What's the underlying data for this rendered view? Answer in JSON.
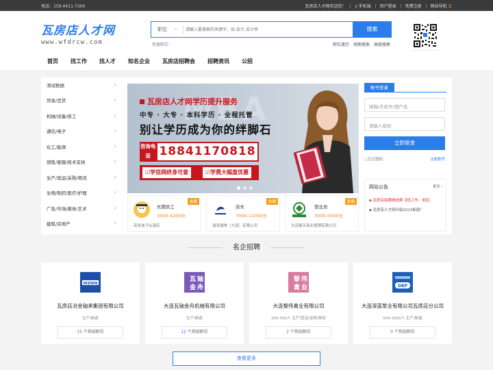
{
  "topbar": {
    "phone": "电话：159-0411-7300",
    "welcome": "瓦房店人才网欢迎您！",
    "mobile": "手机端",
    "login": "用户登录",
    "register": "免费注册",
    "site_nav": "网站导航"
  },
  "logo": {
    "cn": "瓦房店人才网",
    "en": "www.wfdrcw.com"
  },
  "search": {
    "select_value": "职位",
    "placeholder": "请输入要搜索的关键字，如:会计,设计师",
    "button": "搜索",
    "hot_label": "热搜职位：",
    "links": [
      "职位速历",
      "地图搜索",
      "高级搜索"
    ]
  },
  "nav": [
    "首页",
    "找工作",
    "找人才",
    "知名企业",
    "瓦房店招聘会",
    "招聘资讯",
    "公招"
  ],
  "categories": [
    "测试数据",
    "贸易/百货",
    "机械/设备/技工",
    "通信/电子",
    "化工/能源",
    "销售/客服/技术支持",
    "生产/营运/采购/物流",
    "生物/制药/医疗/护理",
    "广告/市场/媒体/艺术",
    "建筑/房地产"
  ],
  "banner": {
    "bg_text": "MBA",
    "line1": "瓦房店人才网学历提升服务",
    "line2": "中专 · 大专 · 本科学历 · 全程托管",
    "line3": "别让学历成为你的绊脚石",
    "call": "咨询电话",
    "phone": "18841170818",
    "pill1": "学信网终身可查",
    "pill2": "学费大幅度优惠"
  },
  "jobs": [
    {
      "tag": "急聘",
      "title": "长期员工",
      "salary": "3500-4200元",
      "company": "亮发抹子弘源店"
    },
    {
      "tag": "急聘",
      "title": "店长",
      "salary": "7000-11000元",
      "company": "瑞幸咖啡（大连）有限公司"
    },
    {
      "tag": "急聘",
      "title": "营业员",
      "salary": "3000-5000元",
      "company": "大连春天商业管理有限公司"
    }
  ],
  "login": {
    "tab": "账号登录",
    "user_placeholder": "邮箱/手机号/用户名",
    "pwd_placeholder": "请输入密码",
    "button": "立即登录",
    "forgot": "忘记密码",
    "register": "注册账号"
  },
  "notice": {
    "title": "网站公告",
    "more": "更多",
    "items": [
      "瓦房店招聘微信群【找工作、发招…",
      "瓦房店人才网升级2023新版！"
    ]
  },
  "section_title": "名企招聘",
  "companies": [
    {
      "logo_text": "WZWN",
      "name": "瓦房店冶金轴承集团有限公司",
      "meta": "生产/制造",
      "count": "15",
      "count_suffix": "个热招职位"
    },
    {
      "logo_text": "瓦轴金舟",
      "name": "大连瓦轴金舟机械有限公司",
      "meta": "生产/制造",
      "count": "12",
      "count_suffix": "个热招职位"
    },
    {
      "logo_text": "黎伟禽业",
      "name": "大连黎伟禽业有限公司",
      "meta": "200-500人  生产/营运/采购/物流",
      "count": "2",
      "count_suffix": "个热招职位"
    },
    {
      "logo_text": "DBP",
      "name": "大连深蓝泵业有限公司瓦房店分公司",
      "meta": "500-1000人  生产/制造",
      "count": "0",
      "count_suffix": "个热招职位"
    }
  ],
  "more_button": "查看更多",
  "colors": {
    "brand": "#2b7de9",
    "accent_red": "#c8161d",
    "salary": "#f08010",
    "tag": "#f0a020"
  }
}
